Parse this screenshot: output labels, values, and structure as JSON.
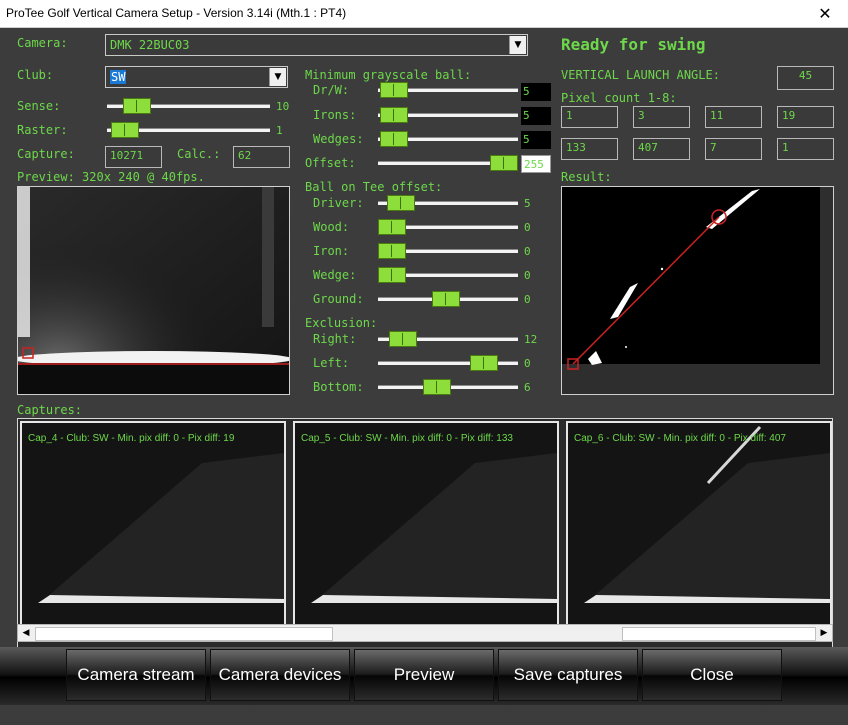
{
  "window": {
    "title": "ProTee Golf Vertical Camera Setup - Version 3.14i (Mth.1 : PT4)",
    "close_glyph": "✕"
  },
  "camera": {
    "label": "Camera:",
    "value": "DMK 22BUC03"
  },
  "club": {
    "label": "Club:",
    "value": "SW"
  },
  "sense": {
    "label": "Sense:",
    "value": "10",
    "level": 0.12
  },
  "raster": {
    "label": "Raster:",
    "value": "1",
    "level": 0.03
  },
  "capture": {
    "label": "Capture:",
    "value": "10271",
    "calc_label": "Calc.:",
    "calc_value": "62"
  },
  "preview": {
    "label": "Preview: 320x 240 @ 40fps."
  },
  "grayscale": {
    "title": "Minimum grayscale ball:",
    "rows": [
      {
        "label": "Dr/W:",
        "value": "5",
        "level": 0.02
      },
      {
        "label": "Irons:",
        "value": "5",
        "level": 0.02
      },
      {
        "label": "Wedges:",
        "value": "5",
        "level": 0.02
      },
      {
        "label": "Offset:",
        "value": "255",
        "level": 1.0
      }
    ]
  },
  "tee": {
    "title": "Ball on Tee offset:",
    "rows": [
      {
        "label": "Driver:",
        "value": "5",
        "level": 0.08
      },
      {
        "label": "Wood:",
        "value": "0",
        "level": 0.0
      },
      {
        "label": "Iron:",
        "value": "0",
        "level": 0.0
      },
      {
        "label": "Wedge:",
        "value": "0",
        "level": 0.0
      },
      {
        "label": "Ground:",
        "value": "0",
        "level": 0.48
      }
    ]
  },
  "exclusion": {
    "title": "Exclusion:",
    "rows": [
      {
        "label": "Right:",
        "value": "12",
        "level": 0.1
      },
      {
        "label": "Left:",
        "value": "0",
        "level": 0.82
      },
      {
        "label": "Bottom:",
        "value": "6",
        "level": 0.4
      }
    ]
  },
  "status": {
    "text": "Ready for swing"
  },
  "launch": {
    "label": "VERTICAL LAUNCH ANGLE:",
    "value": "45"
  },
  "pixels": {
    "label": "Pixel count 1-8:",
    "values": [
      "1",
      "3",
      "11",
      "19",
      "133",
      "407",
      "7",
      "1"
    ]
  },
  "result": {
    "label": "Result:"
  },
  "captures": {
    "label": "Captures:",
    "items": [
      "Cap_4 - Club: SW - Min. pix diff: 0 - Pix diff: 19",
      "Cap_5 - Club: SW - Min. pix diff: 0 - Pix diff: 133",
      "Cap_6 - Club: SW - Min. pix diff: 0 - Pix diff: 407"
    ]
  },
  "buttons": {
    "camera_stream": "Camera stream",
    "camera_devices": "Camera devices",
    "preview": "Preview",
    "save_captures": "Save captures",
    "close": "Close"
  },
  "colors": {
    "accent_green": "#6dd84a",
    "thumb_green": "#8dde3a",
    "background": "#3c3c3c"
  }
}
